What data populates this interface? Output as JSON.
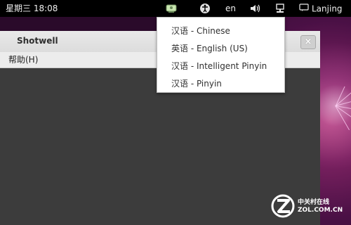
{
  "top_panel": {
    "clock": "星期三 18:08",
    "language_indicator": "en",
    "user_name": "Lanjing"
  },
  "window": {
    "title": "Shotwell",
    "menu": {
      "help": "帮助(H)"
    },
    "close_label": "×"
  },
  "input_menu": {
    "items": [
      {
        "label": "汉语 - Chinese"
      },
      {
        "label": "英语 - English (US)"
      },
      {
        "label": "汉语 - Intelligent Pinyin"
      },
      {
        "label": "汉语 - Pinyin"
      }
    ]
  },
  "watermark": {
    "logo_text_cn": "中关村在线",
    "logo_text_en": "ZOL.COM.CN"
  },
  "colors": {
    "panel_bg": "#000000",
    "window_body": "#3c3c3c",
    "desktop_accent": "#7a2160"
  },
  "icons": [
    "network-icon",
    "accessibility-icon",
    "volume-icon",
    "wired-network-icon",
    "chat-icon",
    "close-icon"
  ]
}
